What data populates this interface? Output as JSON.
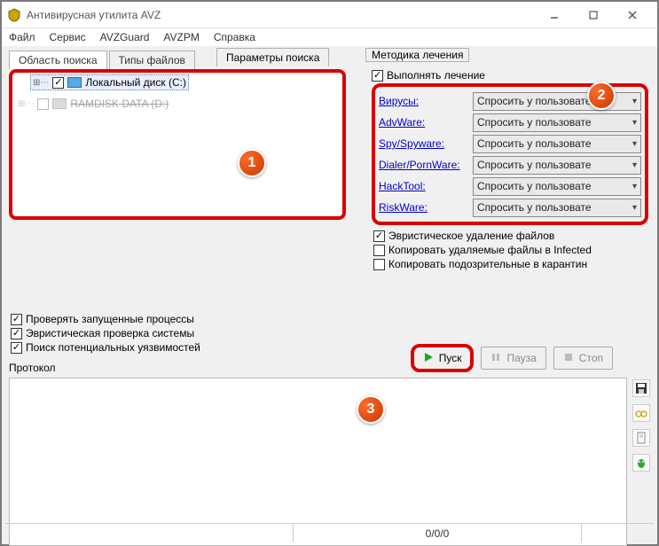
{
  "window": {
    "title": "Антивирусная утилита AVZ"
  },
  "menu": {
    "file": "Файл",
    "service": "Сервис",
    "guard": "AVZGuard",
    "pm": "AVZPM",
    "help": "Справка"
  },
  "tabs": {
    "area": "Область поиска",
    "types": "Типы файлов",
    "params": "Параметры поиска"
  },
  "drives": {
    "c": "Локальный диск (C:)",
    "other": "RAMDISK DATA (D:)"
  },
  "legend": "Методика лечения",
  "treat_checkbox": "Выполнять лечение",
  "categories": {
    "virus": "Вирусы:",
    "adware": "AdvWare:",
    "spy": "Spy/Spyware:",
    "dialer": "Dialer/PornWare:",
    "hacktool": "HackTool:",
    "riskware": "RiskWare:"
  },
  "select_value": "Спросить у пользовате",
  "opts": {
    "heuristic": "Эвристическое удаление файлов",
    "copy_infected": "Копировать удаляемые файлы в  Infected",
    "copy_quarantine": "Копировать подозрительные в  карантин"
  },
  "left_checks": {
    "processes": "Проверять запущенные процессы",
    "sys": "Эвристическая проверка системы",
    "vuln": "Поиск потенциальных уязвимостей"
  },
  "buttons": {
    "start": "Пуск",
    "pause": "Пауза",
    "stop": "Стоп"
  },
  "protocol": "Протокол",
  "status": "0/0/0",
  "callouts": {
    "c1": "1",
    "c2": "2",
    "c3": "3"
  }
}
